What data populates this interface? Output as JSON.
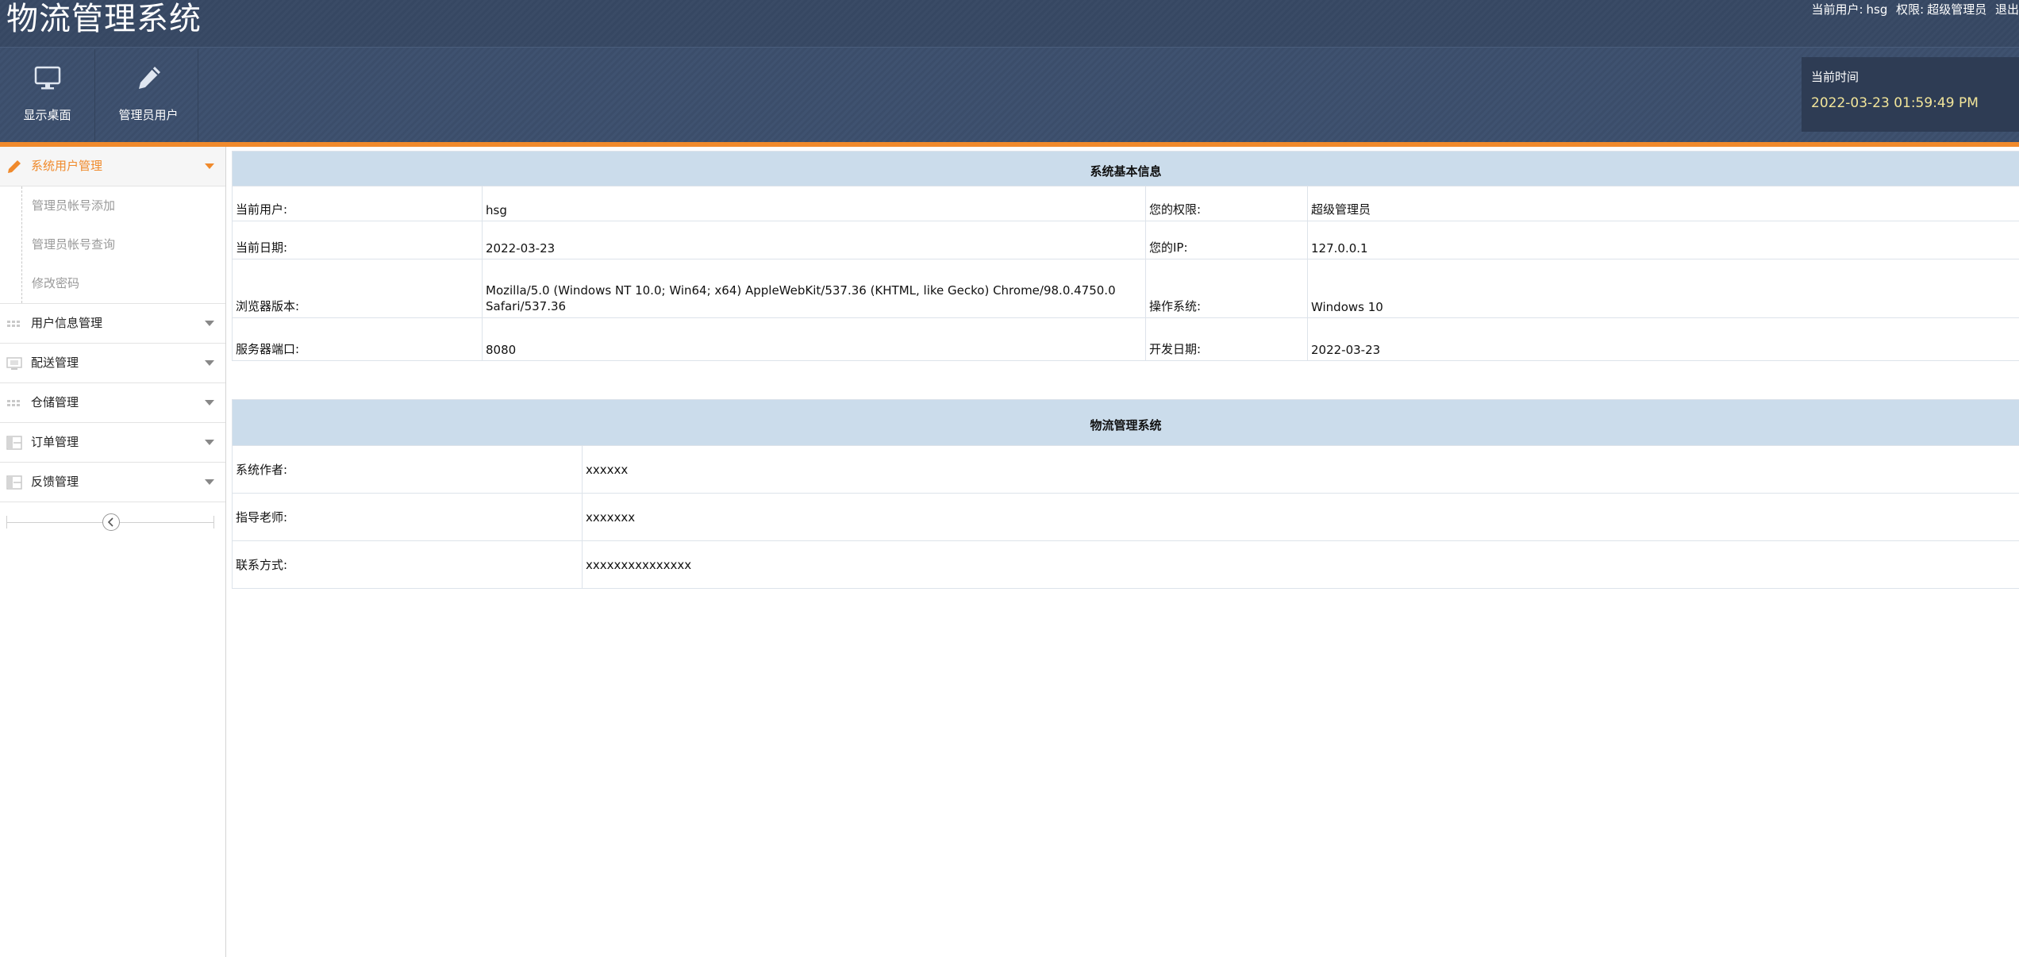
{
  "header": {
    "app_title": "物流管理系统",
    "user_label": "当前用户:",
    "username": "hsg",
    "role_label": "权限:",
    "role": "超级管理员",
    "logout": "退出",
    "nav": [
      {
        "label": "显示桌面",
        "icon": "monitor-icon"
      },
      {
        "label": "管理员用户",
        "icon": "pencil-icon"
      }
    ],
    "time_label": "当前时间",
    "time_value": "2022-03-23 01:59:49 PM"
  },
  "colors": {
    "header_bg": "#3d4f6c",
    "accent": "#f08a2c",
    "table_head": "#cbdceb",
    "time_text": "#f2e59a"
  },
  "sidebar": {
    "menus": [
      {
        "label": "系统用户管理",
        "icon": "pencil-icon",
        "expanded": true,
        "items": [
          "管理员帐号添加",
          "管理员帐号查询",
          "修改密码"
        ]
      },
      {
        "label": "用户信息管理",
        "icon": "grid-icon"
      },
      {
        "label": "配送管理",
        "icon": "monitor-icon"
      },
      {
        "label": "仓储管理",
        "icon": "grid-icon"
      },
      {
        "label": "订单管理",
        "icon": "layout-icon"
      },
      {
        "label": "反馈管理",
        "icon": "layout-icon"
      }
    ],
    "collapse_icon": "chevron-left-icon"
  },
  "system_info": {
    "title": "系统基本信息",
    "rows": [
      {
        "l1": "当前用户:",
        "v1": "hsg",
        "l2": "您的权限:",
        "v2": "超级管理员"
      },
      {
        "l1": "当前日期:",
        "v1": "2022-03-23",
        "l2": "您的IP:",
        "v2": "127.0.0.1"
      },
      {
        "l1": "浏览器版本:",
        "v1": "Mozilla/5.0 (Windows NT 10.0; Win64; x64) AppleWebKit/537.36 (KHTML, like Gecko) Chrome/98.0.4750.0 Safari/537.36",
        "l2": "操作系统:",
        "v2": "Windows 10"
      },
      {
        "l1": "服务器端口:",
        "v1": "8080",
        "l2": "开发日期:",
        "v2": "2022-03-23"
      }
    ]
  },
  "about": {
    "title": "物流管理系统",
    "rows": [
      {
        "label": "系统作者:",
        "value": "xxxxxx"
      },
      {
        "label": "指导老师:",
        "value": "xxxxxxx"
      },
      {
        "label": "联系方式:",
        "value": "xxxxxxxxxxxxxxx"
      }
    ]
  }
}
